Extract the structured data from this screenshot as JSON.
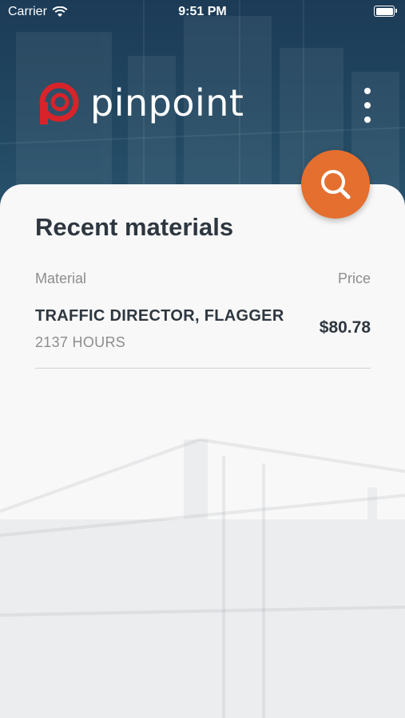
{
  "status_bar": {
    "carrier": "Carrier",
    "time": "9:51 PM"
  },
  "brand": {
    "name": "pinpoint",
    "accent": "#e56f2f",
    "logo_red": "#d8232a",
    "header_color": "#1f4159"
  },
  "icons": {
    "menu": "more-vertical-icon",
    "search": "search-icon",
    "wifi": "wifi-icon",
    "battery": "battery-icon"
  },
  "recent": {
    "title": "Recent materials",
    "columns": {
      "material": "Material",
      "price": "Price"
    },
    "items": [
      {
        "name": "TRAFFIC DIRECTOR, FLAGGER",
        "quantity": "2137 HOURS",
        "price": "$80.78"
      }
    ]
  }
}
